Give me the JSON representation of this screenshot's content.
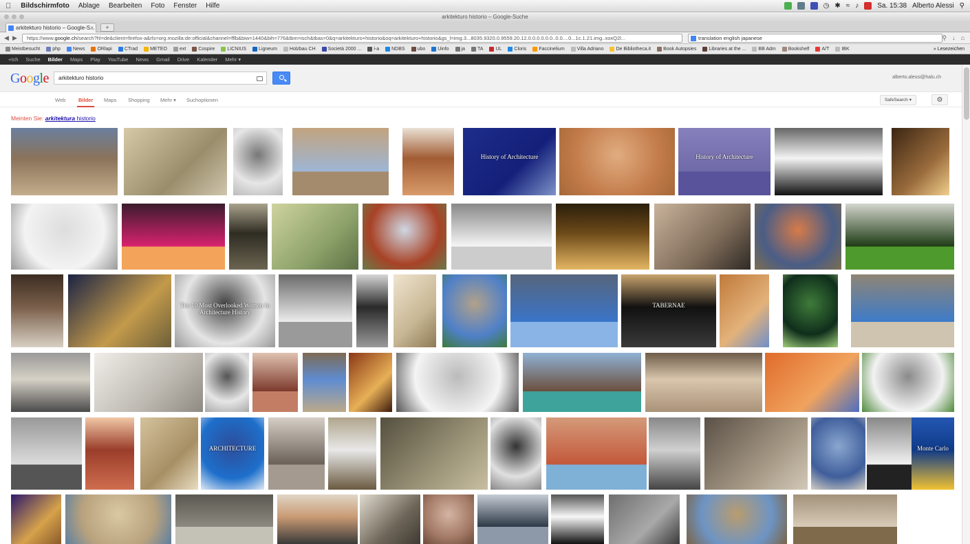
{
  "menubar": {
    "app": "Bildschirmfoto",
    "items": [
      "Ablage",
      "Bearbeiten",
      "Foto",
      "Fenster",
      "Hilfe"
    ],
    "clock": "Sa. 15:38",
    "user": "Alberto Alessi"
  },
  "window": {
    "title": "arkitekturo historio – Google-Suche"
  },
  "tab": {
    "label": "arkitekturo historio – Google-S..."
  },
  "url": {
    "prefix": "https://www.",
    "domain": "google.ch",
    "rest": "/search?hl=de&client=firefox-a&rls=org.mozilla:de:official&channel=fflb&biw=1440&bih=776&tbm=isch&tbas=0&q=arkitekturo+historio&oq=arkitekturo+historio&gs_l=img.3...8035.9320.0.9559.20.12.0.0.0.0.0.0..0.0....0...1c.1.21.img..xoxQ2l..."
  },
  "searchbar": {
    "value": "translation english japanese"
  },
  "bookmarks": [
    {
      "label": "Meistbesucht",
      "color": "#888"
    },
    {
      "label": "php",
      "color": "#6c7eb7"
    },
    {
      "label": "News",
      "color": "#4285f4"
    },
    {
      "label": "ORlapi",
      "color": "#e8710a"
    },
    {
      "label": "CTrad",
      "color": "#2a7ae2"
    },
    {
      "label": "METEO",
      "color": "#f4b400"
    },
    {
      "label": "ext",
      "color": "#9e9e9e"
    },
    {
      "label": "Cospire",
      "color": "#795548"
    },
    {
      "label": "LICNIUS",
      "color": "#8bc34a"
    },
    {
      "label": "Ligneum",
      "color": "#1565c0"
    },
    {
      "label": "Holzbau CH",
      "color": "#bbb"
    },
    {
      "label": "Società 2000 ...",
      "color": "#3949ab"
    },
    {
      "label": "i-a",
      "color": "#555"
    },
    {
      "label": "NDBS",
      "color": "#1e88e5"
    },
    {
      "label": "ubo",
      "color": "#6d4c41"
    },
    {
      "label": "Uinfo",
      "color": "#1976d2"
    },
    {
      "label": "ja",
      "color": "#777"
    },
    {
      "label": "TA",
      "color": "#777"
    },
    {
      "label": "UL",
      "color": "#c62828"
    },
    {
      "label": "Cloris",
      "color": "#1e88e5"
    },
    {
      "label": "Faccinelium",
      "color": "#ff9800"
    },
    {
      "label": "Villa Adriano",
      "color": "#bbb"
    },
    {
      "label": "De Bibliotheca.it",
      "color": "#fbc02d"
    },
    {
      "label": "Book Autopsies",
      "color": "#8d6e63"
    },
    {
      "label": "Libraries at the ...",
      "color": "#5d4037"
    },
    {
      "label": "BB Adm",
      "color": "#bbb"
    },
    {
      "label": "Bookshelf",
      "color": "#a1887f"
    },
    {
      "label": "A/T",
      "color": "#e53935"
    },
    {
      "label": "IBK",
      "color": "#bbb"
    }
  ],
  "bookmarks_more": "Lesezeichen",
  "gbar": {
    "items": [
      "+Ich",
      "Suche",
      "Bilder",
      "Maps",
      "Play",
      "YouTube",
      "News",
      "Gmail",
      "Drive",
      "Kalender",
      "Mehr"
    ],
    "active": "Bilder"
  },
  "search": {
    "query": "arkitekturo historio",
    "user": "alberto.alessi@halu.ch"
  },
  "tools": {
    "tabs": [
      "Web",
      "Bilder",
      "Maps",
      "Shopping",
      "Mehr",
      "Suchoptionen"
    ],
    "active": "Bilder",
    "safesearch": "SafeSearch"
  },
  "didyoumean": {
    "prefix": "Meinten Sie:",
    "bold": "arkitektura",
    "rest": " historio"
  },
  "thumbnails": [
    {
      "name": "colosseum",
      "c": [
        "#8a735a",
        "#c4ad8c",
        "#6b7f9e"
      ]
    },
    {
      "name": "pyramids-haze",
      "c": [
        "#d6c9a6",
        "#9a8d6c",
        "#cfc5ac"
      ]
    },
    {
      "name": "sketch-collage",
      "c": [
        "#e6e6e6",
        "#777",
        "#bbb"
      ]
    },
    {
      "name": "acropolis",
      "c": [
        "#9db6d6",
        "#a58b6d",
        "#c2a37e"
      ]
    },
    {
      "name": "palace-fine-arts",
      "c": [
        "#a25c33",
        "#d89b6a",
        "#eae0d4"
      ]
    },
    {
      "name": "history-slide-blue",
      "c": [
        "#1d2d8a",
        "#14207a",
        "#7e93c9"
      ],
      "text": "History of Architecture"
    },
    {
      "name": "giza-pyramids",
      "c": [
        "#c37b4a",
        "#e0ad80",
        "#a66939"
      ]
    },
    {
      "name": "history-slide-purple",
      "c": [
        "#6f6aa8",
        "#58539a",
        "#8681bd"
      ],
      "text": "History of Architecture"
    },
    {
      "name": "black-white-wave",
      "c": [
        "#f4f4f4",
        "#111",
        "#666"
      ]
    },
    {
      "name": "cloister",
      "c": [
        "#3b2613",
        "#9a6b3c",
        "#f0cf8d"
      ]
    },
    {
      "name": "line-drawing",
      "c": [
        "#f3f3f3",
        "#ddd",
        "#999"
      ]
    },
    {
      "name": "stonehenge",
      "c": [
        "#d9226f",
        "#f3a35a",
        "#3b1c2e"
      ]
    },
    {
      "name": "cave-stairs",
      "c": [
        "#2f2c23",
        "#6b6451",
        "#a9a38c"
      ]
    },
    {
      "name": "green-drawing",
      "c": [
        "#cfd39e",
        "#8ea26b",
        "#5d7146"
      ]
    },
    {
      "name": "pagoda",
      "c": [
        "#a84226",
        "#cfd7e3",
        "#6b7b4a"
      ]
    },
    {
      "name": "axonometric",
      "c": [
        "#f6f6f6",
        "#ccc",
        "#888"
      ]
    },
    {
      "name": "baroque-facade",
      "c": [
        "#6d4a18",
        "#e4b664",
        "#2a1e0c"
      ]
    },
    {
      "name": "man-corridor",
      "c": [
        "#c9b39b",
        "#7d6a58",
        "#2f2a25"
      ]
    },
    {
      "name": "colorful-city",
      "c": [
        "#4a5d86",
        "#d77b48",
        "#7d6e4f"
      ]
    },
    {
      "name": "marble-feet",
      "c": [
        "#1e3b14",
        "#4f9a2c",
        "#d3d5cc"
      ]
    },
    {
      "name": "stair-drawing",
      "c": [
        "#7a5f4a",
        "#d8d0c4",
        "#3c2d22"
      ]
    },
    {
      "name": "greek-temple-dusk",
      "c": [
        "#1b2344",
        "#c39a4b",
        "#6c5f3a"
      ]
    },
    {
      "name": "women-portraits",
      "c": [
        "#e5e5e5",
        "#444",
        "#999"
      ],
      "text": "The 10 Most Overlooked Women In Architecture History"
    },
    {
      "name": "folded-paper",
      "c": [
        "#ececec",
        "#9a9a9a",
        "#6a6a6a"
      ]
    },
    {
      "name": "woman-bw",
      "c": [
        "#2a2a2a",
        "#9a9a9a",
        "#d6d6d6"
      ]
    },
    {
      "name": "book-cover",
      "c": [
        "#efe4cf",
        "#c7b693",
        "#8d7a56"
      ]
    },
    {
      "name": "modern-building",
      "c": [
        "#4f80c8",
        "#b2a18a",
        "#3d7a3b"
      ]
    },
    {
      "name": "skyline",
      "c": [
        "#3a74c9",
        "#8ab4e6",
        "#56657c"
      ]
    },
    {
      "name": "tabernae",
      "c": [
        "#111",
        "#3a3a3a",
        "#c9a36d"
      ],
      "text": "TABERNAE"
    },
    {
      "name": "petra",
      "c": [
        "#c07a3a",
        "#e3b27b",
        "#6e8fc9"
      ]
    },
    {
      "name": "green-book",
      "c": [
        "#0f2e1b",
        "#3f7b3a",
        "#a0cf7b"
      ]
    },
    {
      "name": "parthenon",
      "c": [
        "#3d7bc9",
        "#cfc4b0",
        "#8f8575"
      ]
    },
    {
      "name": "open-book",
      "c": [
        "#d6d1c6",
        "#4a4a4a",
        "#999"
      ]
    },
    {
      "name": "white-model",
      "c": [
        "#f0eee9",
        "#bdb9b1",
        "#8e8a82"
      ]
    },
    {
      "name": "woman-portrait",
      "c": [
        "#e6e6e6",
        "#555",
        "#aaa"
      ]
    },
    {
      "name": "cathedral-red",
      "c": [
        "#7d3a2c",
        "#c27d64",
        "#e0c2b0"
      ]
    },
    {
      "name": "cathedral-blue",
      "c": [
        "#5e8cd1",
        "#bca98a",
        "#7d6a55"
      ]
    },
    {
      "name": "mosque-arches",
      "c": [
        "#8a3716",
        "#e7b057",
        "#3d1a0b"
      ]
    },
    {
      "name": "interior-sketch",
      "c": [
        "#f4f4f4",
        "#bbb",
        "#555"
      ]
    },
    {
      "name": "church-brick",
      "c": [
        "#6c4f3d",
        "#3ea39a",
        "#8fb2d4"
      ]
    },
    {
      "name": "relief-carving",
      "c": [
        "#d9c6ad",
        "#a99278",
        "#6e5d4a"
      ]
    },
    {
      "name": "pyramids-sunset",
      "c": [
        "#e06b2b",
        "#f0a35e",
        "#4d6fbf"
      ]
    },
    {
      "name": "modern-complex",
      "c": [
        "#f2f2f2",
        "#8a8a8a",
        "#4e8a3a"
      ]
    },
    {
      "name": "elderly-woman",
      "c": [
        "#dcdcdc",
        "#555",
        "#999"
      ]
    },
    {
      "name": "red-arches",
      "c": [
        "#9a3d2a",
        "#cf6d4f",
        "#f0c7a6"
      ]
    },
    {
      "name": "floor-plan",
      "c": [
        "#d4c29c",
        "#a78f65",
        "#e8dcc0"
      ]
    },
    {
      "name": "architecture-book",
      "c": [
        "#1d6fcb",
        "#2e4d9a",
        "#e0e9f5"
      ],
      "text": "ARCHITECTURE"
    },
    {
      "name": "sagrada-familia",
      "c": [
        "#6a6058",
        "#a59a8f",
        "#d6cfc6"
      ]
    },
    {
      "name": "pipes-objects",
      "c": [
        "#e8e8e8",
        "#6a5a40",
        "#b0a58d"
      ]
    },
    {
      "name": "colosseum-aerial",
      "c": [
        "#54503f",
        "#9c9478",
        "#c7bf9f"
      ]
    },
    {
      "name": "woman-bw-2",
      "c": [
        "#e0e0e0",
        "#333",
        "#888"
      ]
    },
    {
      "name": "humayun-tomb",
      "c": [
        "#c3583a",
        "#7fb0d6",
        "#d49a7a"
      ]
    },
    {
      "name": "two-men",
      "c": [
        "#d0d0d0",
        "#444",
        "#888"
      ]
    },
    {
      "name": "rubble",
      "c": [
        "#5b5147",
        "#a39683",
        "#d3c9b8"
      ]
    },
    {
      "name": "office-building",
      "c": [
        "#3f5e9b",
        "#8aa6cf",
        "#d6d0c2"
      ]
    },
    {
      "name": "window-detail",
      "c": [
        "#f2f2f2",
        "#222",
        "#888"
      ]
    },
    {
      "name": "yellow-book",
      "c": [
        "#0f3a88",
        "#f1c232",
        "#2457b3"
      ],
      "text": "Monte Carlo"
    },
    {
      "name": "colosseum-night",
      "c": [
        "#2e1a6b",
        "#d6a24b",
        "#8a5a2b"
      ]
    },
    {
      "name": "ruins-people",
      "c": [
        "#b8a27e",
        "#d9c9a3",
        "#5e7fa0"
      ]
    },
    {
      "name": "concrete-slab",
      "c": [
        "#8c8a80",
        "#c4c1b6",
        "#5a5850"
      ]
    },
    {
      "name": "bald-man",
      "c": [
        "#c99a74",
        "#3a3a3a",
        "#e0d6c6"
      ]
    },
    {
      "name": "old-photo",
      "c": [
        "#e0dbcf",
        "#6e6658",
        "#3e3a33"
      ]
    },
    {
      "name": "ornament",
      "c": [
        "#a37a66",
        "#d4b4a3",
        "#6d4b3b"
      ]
    },
    {
      "name": "statue",
      "c": [
        "#2f3a48",
        "#8d99a8",
        "#c5ccd5"
      ]
    },
    {
      "name": "silhouettes",
      "c": [
        "#f7f7f7",
        "#111",
        "#555"
      ]
    },
    {
      "name": "amphitheater",
      "c": [
        "#6f6f6f",
        "#a9a9a9",
        "#3b3b3b"
      ]
    },
    {
      "name": "ruins-sky",
      "c": [
        "#6d94c4",
        "#b99c6f",
        "#7a6448"
      ]
    },
    {
      "name": "instruments",
      "c": [
        "#d8cbb8",
        "#7f6a4c",
        "#a3927a"
      ]
    }
  ]
}
